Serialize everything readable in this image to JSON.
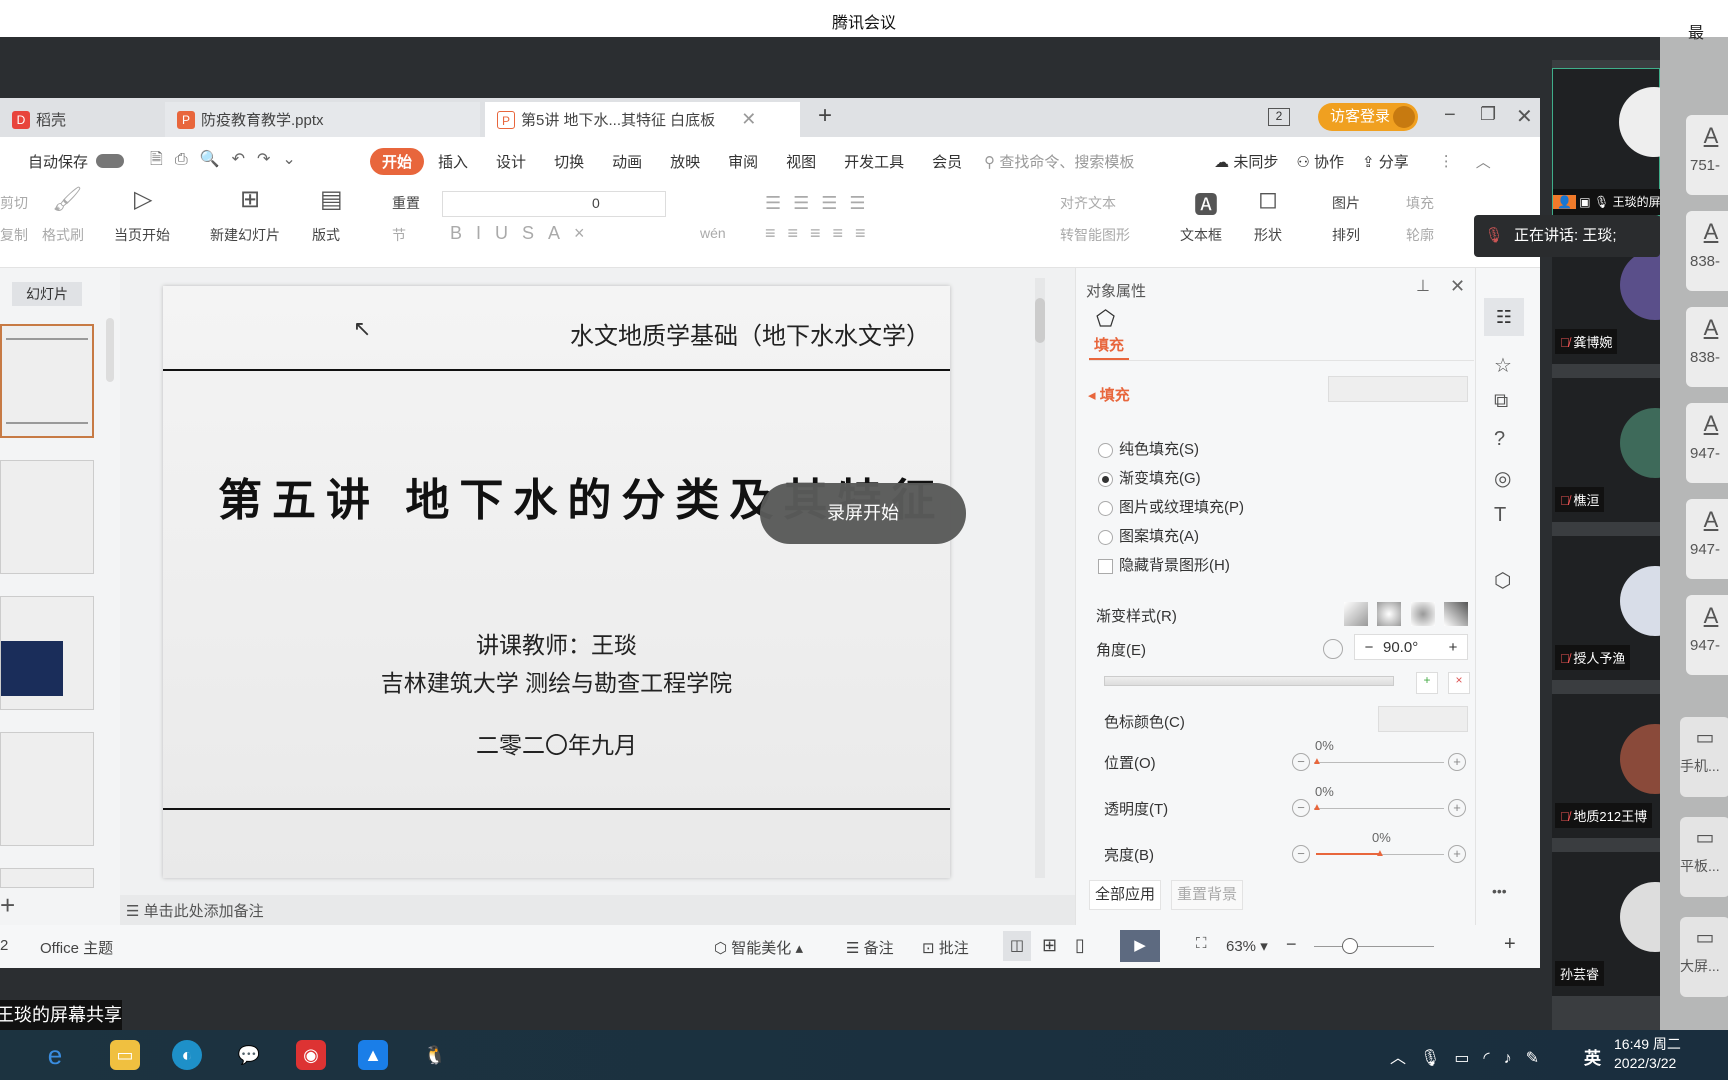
{
  "window": {
    "title": "腾讯会议",
    "overlay_top_label": "最"
  },
  "colors": {
    "accent": "#e8663c",
    "login": "#f0a020",
    "dark_bg": "#2b2e31"
  },
  "tabs": [
    {
      "label": "稻壳",
      "icon": "daoke-icon"
    },
    {
      "label": "防疫教育教学.pptx",
      "icon": "ppt-icon"
    },
    {
      "label": "第5讲 地下水...其特征 白底板",
      "icon": "ppt-icon",
      "active": true
    }
  ],
  "tabbar": {
    "new_tab": "+",
    "window_count": "2",
    "login": "访客登录"
  },
  "menubar": {
    "autosave": "自动保存",
    "items": [
      "开始",
      "插入",
      "设计",
      "切换",
      "动画",
      "放映",
      "审阅",
      "视图",
      "开发工具",
      "会员"
    ],
    "search_placeholder": "查找命令、搜索模板",
    "sync": "未同步",
    "collab": "协作",
    "share": "分享"
  },
  "ribbon": {
    "cut": "剪切",
    "copy": "复制",
    "format_painter": "格式刷",
    "play_current": "当页开始",
    "new_slide": "新建幻灯片",
    "layout": "版式",
    "reset": "重置",
    "section": "节",
    "font_size": "0",
    "align_text": "对齐文本",
    "smart_shape": "转智能图形",
    "textbox": "文本框",
    "shape": "形状",
    "picture": "图片",
    "fill": "填充",
    "arrange": "排列",
    "outline": "轮廓",
    "pinyin": "wén"
  },
  "slides_panel": {
    "title": "幻灯片",
    "add": "+"
  },
  "slide": {
    "header": "水文地质学基础（地下水水文学）",
    "title": "第五讲 地下水的分类及其特征",
    "teacher": "讲课教师：王琰",
    "school": "吉林建筑大学 测绘与勘查工程学院",
    "date": "二零二〇年九月"
  },
  "recording_badge": "录屏开始",
  "notes_placeholder": "单击此处添加备注",
  "props": {
    "title": "对象属性",
    "tab": "填充",
    "section": "填充",
    "options": [
      {
        "label": "纯色填充(S)",
        "selected": false
      },
      {
        "label": "渐变填充(G)",
        "selected": true
      },
      {
        "label": "图片或纹理填充(P)",
        "selected": false
      },
      {
        "label": "图案填充(A)",
        "selected": false
      }
    ],
    "hide_bg": "隐藏背景图形(H)",
    "gradient_style": "渐变样式(R)",
    "angle_label": "角度(E)",
    "angle_value": "90.0°",
    "stop_color": "色标颜色(C)",
    "position_label": "位置(O)",
    "position_value": "0%",
    "transparency_label": "透明度(T)",
    "transparency_value": "0%",
    "brightness_label": "亮度(B)",
    "brightness_value": "0%",
    "brightness_level": 0.5,
    "apply_all": "全部应用",
    "reset_bg": "重置背景"
  },
  "statusbar": {
    "slide_num": "2",
    "theme": "Office 主题",
    "beautify": "智能美化",
    "notes": "备注",
    "comment": "批注",
    "zoom": "63%",
    "zoom_level": 0.3
  },
  "participants": [
    {
      "name": "王琰的屏幕共享",
      "speaking": true
    },
    {
      "name": "龚博婉"
    },
    {
      "name": "樵洹"
    },
    {
      "name": "授人予渔"
    },
    {
      "name": "地质212王博"
    },
    {
      "name": "孙芸睿"
    }
  ],
  "speaking_tooltip": "正在讲话: 王琰;",
  "overlay_items": [
    "751-",
    "838-",
    "838-",
    "947-",
    "947-",
    "947-"
  ],
  "device_items": [
    "手机...",
    "平板...",
    "大屏..."
  ],
  "share_label": "王琰的屏幕共享",
  "taskbar": {
    "ime": "英",
    "time": "16:49 周二",
    "date": "2022/3/22"
  }
}
